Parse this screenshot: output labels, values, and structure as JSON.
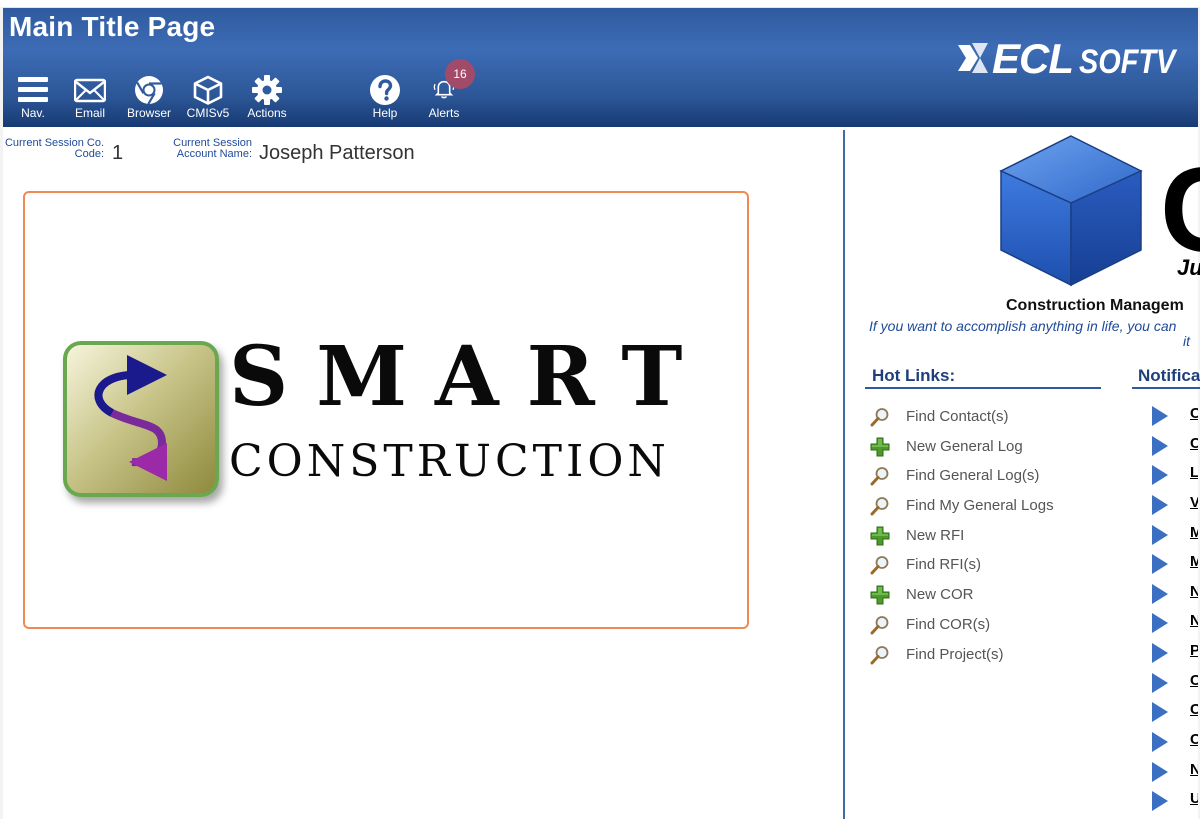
{
  "header": {
    "title": "Main Title Page",
    "brand_logo_text": "ECL SOFTWARE",
    "toolbar": [
      {
        "label": "Nav.",
        "icon": "hamburger-menu-icon"
      },
      {
        "label": "Email",
        "icon": "envelope-icon"
      },
      {
        "label": "Browser",
        "icon": "chrome-browser-icon"
      },
      {
        "label": "CMISv5",
        "icon": "cube-icon"
      },
      {
        "label": "Actions",
        "icon": "gear-icon"
      },
      {
        "label": "Help",
        "icon": "question-circle-icon"
      },
      {
        "label": "Alerts",
        "icon": "bell-icon",
        "badge": "16"
      }
    ]
  },
  "session": {
    "company_code_label_line1": "Current Session Co.",
    "company_code_label_line2": "Code:",
    "company_code_value": "1",
    "account_label_line1": "Current Session",
    "account_label_line2": "Account Name:",
    "account_value": "Joseph Patterson"
  },
  "logo_panel": {
    "title": "SMART",
    "subtitle": "CONSTRUCTION"
  },
  "right_panel": {
    "logo_letter": "C",
    "logo_tagline_fragment": "Ju",
    "product_title": "Construction Managem",
    "quote_line1": "If you want to accomplish anything in life, you can",
    "quote_line2": "it",
    "hot_links_heading": "Hot Links:",
    "notifications_heading": "Notifica",
    "hot_links": [
      {
        "label": "Find Contact(s)",
        "icon": "magnifier-icon"
      },
      {
        "label": "New General Log",
        "icon": "green-plus-icon"
      },
      {
        "label": "Find General Log(s)",
        "icon": "magnifier-icon"
      },
      {
        "label": "Find My General Logs",
        "icon": "magnifier-icon"
      },
      {
        "label": "New RFI",
        "icon": "green-plus-icon"
      },
      {
        "label": "Find RFI(s)",
        "icon": "magnifier-icon"
      },
      {
        "label": "New COR",
        "icon": "green-plus-icon"
      },
      {
        "label": "Find COR(s)",
        "icon": "magnifier-icon"
      },
      {
        "label": "Find Project(s)",
        "icon": "magnifier-icon"
      }
    ],
    "notifications": [
      {
        "label": "C"
      },
      {
        "label": "C"
      },
      {
        "label": "L"
      },
      {
        "label": "V"
      },
      {
        "label": "M"
      },
      {
        "label": "M"
      },
      {
        "label": "N"
      },
      {
        "label": "N"
      },
      {
        "label": "P"
      },
      {
        "label": "C"
      },
      {
        "label": "C"
      },
      {
        "label": "C"
      },
      {
        "label": "N"
      },
      {
        "label": "U"
      }
    ]
  },
  "colors": {
    "header_blue": "#2f5a9e",
    "label_blue": "#1f4a9a",
    "badge": "#a14a6a",
    "panel_border": "#f08a52",
    "triangle_blue": "#3b6fc2",
    "plus_green": "#4c9a2a"
  }
}
